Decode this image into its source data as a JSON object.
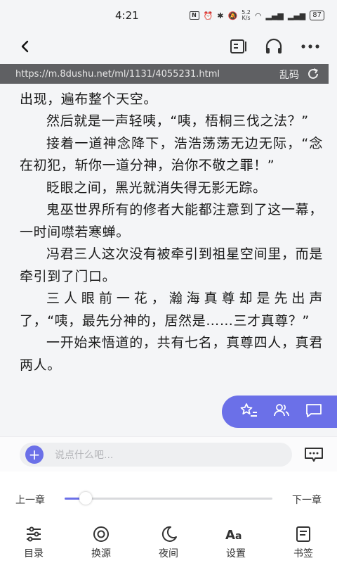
{
  "status": {
    "time": "4:21",
    "net_speed": "5.2\nK/s",
    "battery": "87"
  },
  "url_bar": {
    "url": "https://m.8dushu.net/ml/1131/4055231.html",
    "garbled_label": "乱码"
  },
  "reader": {
    "paragraphs": [
      "然而紧接着，一声巨响传来，无数个黑点蓦地出现，遍布整个天空。",
      "然后就是一声轻咦，“咦，梧桐三伐之法？”",
      "接着一道神念降下，浩浩荡荡无边无际，“念在初犯，斩你一道分神，治你不敬之罪！”",
      "眨眼之间，黑光就消失得无影无踪。",
      "鬼巫世界所有的修者大能都注意到了这一幕，一时间噤若寒蝉。",
      "冯君三人这次没有被牵引到祖星空间里，而是牵引到了门口。",
      "三人眼前一花，瀚海真尊却是先出声了，“咦，最先分神的，居然是……三才真尊？”",
      "一开始来悟道的，共有七名，真尊四人，真君两人。"
    ]
  },
  "comment": {
    "placeholder": "说点什么吧..."
  },
  "chapter_nav": {
    "prev": "上一章",
    "next": "下一章",
    "progress": 0.1
  },
  "bottom_nav": {
    "items": [
      {
        "label": "目录",
        "icon": "catalog-icon"
      },
      {
        "label": "换源",
        "icon": "switch-source-icon"
      },
      {
        "label": "夜间",
        "icon": "moon-icon"
      },
      {
        "label": "设置",
        "icon": "font-settings-icon"
      },
      {
        "label": "书签",
        "icon": "bookmark-icon"
      }
    ]
  },
  "colors": {
    "accent": "#6b70e8",
    "url_bar_bg": "#5f6063",
    "page_bg": "#f4f5f7"
  }
}
